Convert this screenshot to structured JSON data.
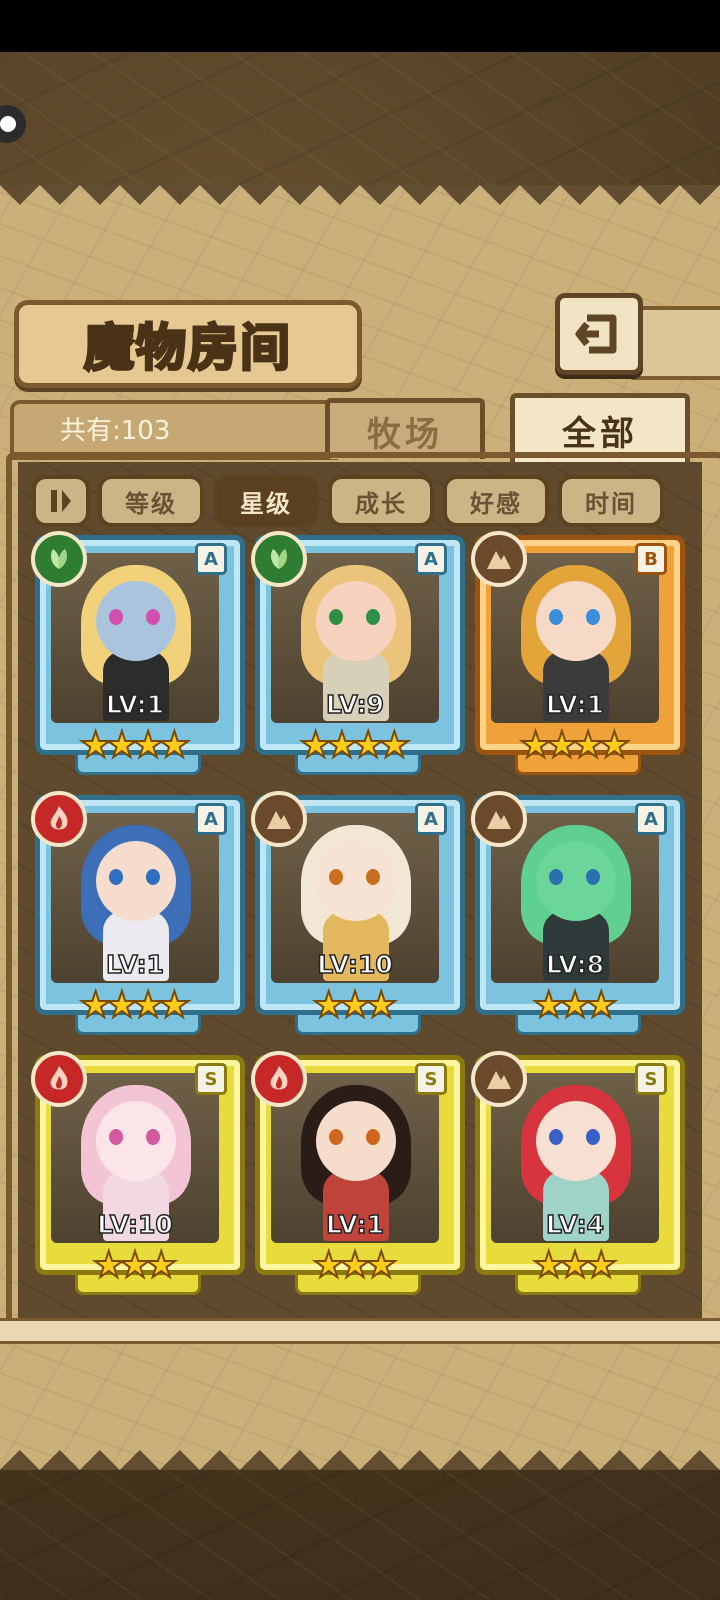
{
  "screen": {
    "title": "魔物房间",
    "count_label": "共有:103",
    "tabs": [
      {
        "label": "牧场",
        "active": false
      },
      {
        "label": "全部",
        "active": true
      }
    ],
    "filters": [
      {
        "label": "等级",
        "active": false
      },
      {
        "label": "星级",
        "active": true
      },
      {
        "label": "成长",
        "active": false
      },
      {
        "label": "好感",
        "active": false
      },
      {
        "label": "时间",
        "active": false
      }
    ],
    "monsters": [
      {
        "level_text": "LV:1",
        "rank": "A",
        "element": "grass",
        "stars": 4,
        "frame": "blue",
        "colors": {
          "hair": "#f1d27a",
          "skin": "#a9c4dc",
          "outfit": "#2c2c2c",
          "eye": "#d24fb0"
        }
      },
      {
        "level_text": "LV:9",
        "rank": "A",
        "element": "grass",
        "stars": 4,
        "frame": "blue",
        "colors": {
          "hair": "#e9c47a",
          "skin": "#f7d2bf",
          "outfit": "#d6d0b8",
          "eye": "#2f8f45"
        }
      },
      {
        "level_text": "LV:1",
        "rank": "B",
        "element": "earth",
        "stars": 4,
        "frame": "orange",
        "colors": {
          "hair": "#e3a53a",
          "skin": "#f6d9c7",
          "outfit": "#3b3b3b",
          "eye": "#3a8fd8"
        }
      },
      {
        "level_text": "LV:1",
        "rank": "A",
        "element": "fire",
        "stars": 4,
        "frame": "blue",
        "colors": {
          "hair": "#3c6fb8",
          "skin": "#f6dccc",
          "outfit": "#eaeaf0",
          "eye": "#2f6fbf"
        }
      },
      {
        "level_text": "LV:10",
        "rank": "A",
        "element": "earth",
        "stars": 3,
        "frame": "blue",
        "colors": {
          "hair": "#f1e7d4",
          "skin": "#f6e3d4",
          "outfit": "#e3b85e",
          "eye": "#c8701f"
        }
      },
      {
        "level_text": "LV:8",
        "rank": "A",
        "element": "earth",
        "stars": 3,
        "frame": "blue",
        "colors": {
          "hair": "#5fd08f",
          "skin": "#6cd59a",
          "outfit": "#2f3a3a",
          "eye": "#2a6fb0"
        }
      },
      {
        "level_text": "LV:10",
        "rank": "S",
        "element": "fire",
        "stars": 3,
        "frame": "yellow",
        "colors": {
          "hair": "#f3c3d6",
          "skin": "#fbe5e8",
          "outfit": "#f1d8e2",
          "eye": "#d35aa0"
        }
      },
      {
        "level_text": "LV:1",
        "rank": "S",
        "element": "fire",
        "stars": 3,
        "frame": "yellow",
        "colors": {
          "hair": "#2a1d17",
          "skin": "#f6dccb",
          "outfit": "#c0443a",
          "eye": "#d0661e"
        }
      },
      {
        "level_text": "LV:4",
        "rank": "S",
        "element": "earth",
        "stars": 3,
        "frame": "yellow",
        "colors": {
          "hair": "#d8343e",
          "skin": "#f7dfd1",
          "outfit": "#9fd3c7",
          "eye": "#3a5fc8"
        }
      }
    ],
    "element_colors": {
      "grass": "#2e7d32",
      "earth": "#6b4a2c",
      "fire": "#c62828"
    },
    "star_glyph": "★"
  }
}
